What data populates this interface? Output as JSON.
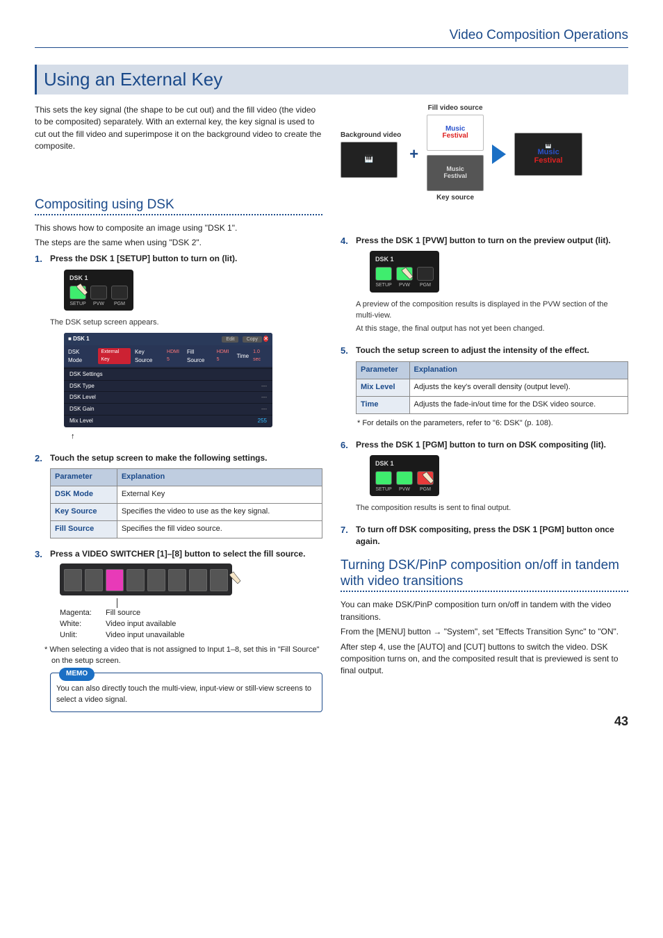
{
  "header": {
    "section_title": "Video Composition Operations"
  },
  "page_number": "43",
  "h1": "Using an External Key",
  "intro": "This sets the key signal (the shape to be cut out) and the fill video (the video to be composited) separately. With an external key, the key signal is used to cut out the fill video and superimpose it on the background video to create the composite.",
  "compdiag": {
    "bg_label": "Background video",
    "fill_label": "Fill video source",
    "key_label": "Key source",
    "mf1": "Music",
    "mf2": "Festival"
  },
  "h2a": "Compositing using DSK",
  "dsk_intro1": "This shows how to composite an image using \"DSK 1\".",
  "dsk_intro2": "The steps are the same when using \"DSK 2\".",
  "step1": {
    "num": "1.",
    "title": "Press the DSK 1 [SETUP] button to turn on (lit).",
    "after": "The DSK setup screen appears."
  },
  "panel": {
    "title": "DSK 1",
    "b1": "SETUP",
    "b2": "PVW",
    "b3": "PGM"
  },
  "screenshot": {
    "title": "DSK 1",
    "edit": "Edit",
    "copy": "Copy",
    "row2_mode": "DSK Mode",
    "row2_mode_v": "External Key",
    "row2_key": "Key Source",
    "row2_key_v": "HDMI 5",
    "row2_fill": "Fill Source",
    "row2_fill_v": "HDMI 5",
    "row2_time": "Time",
    "row2_time_v": "1.0 sec",
    "rows": [
      {
        "k": "DSK Settings",
        "v": ""
      },
      {
        "k": "DSK Type",
        "v": "---"
      },
      {
        "k": "DSK Level",
        "v": "---"
      },
      {
        "k": "DSK Gain",
        "v": "---"
      },
      {
        "k": "Mix Level",
        "v": "255"
      }
    ]
  },
  "step2": {
    "num": "2.",
    "title": "Touch the setup screen to make the following settings.",
    "table_h1": "Parameter",
    "table_h2": "Explanation",
    "rows": [
      {
        "p": "DSK Mode",
        "e": "External Key"
      },
      {
        "p": "Key Source",
        "e": "Specifies the video to use as the key signal."
      },
      {
        "p": "Fill Source",
        "e": "Specifies the fill video source."
      }
    ]
  },
  "step3": {
    "num": "3.",
    "title": "Press a VIDEO SWITCHER [1]–[8] button to select the fill source.",
    "legend": [
      {
        "l": "Magenta:",
        "v": "Fill source"
      },
      {
        "l": "White:",
        "v": "Video input available"
      },
      {
        "l": "Unlit:",
        "v": "Video input unavailable"
      }
    ],
    "note": "* When selecting a video that is not assigned to Input 1–8, set this in \"Fill Source\" on the setup screen.",
    "memo_label": "MEMO",
    "memo": "You can also directly touch the multi-view, input-view or still-view screens to select a video signal."
  },
  "step4": {
    "num": "4.",
    "title": "Press the DSK 1 [PVW] button to turn on the preview output (lit).",
    "after1": "A preview of the composition results is displayed in the PVW section of the multi-view.",
    "after2": "At this stage, the final output has not yet been changed."
  },
  "step5": {
    "num": "5.",
    "title": "Touch the setup screen to adjust the intensity of the effect.",
    "table_h1": "Parameter",
    "table_h2": "Explanation",
    "rows": [
      {
        "p": "Mix Level",
        "e": "Adjusts the key's overall density (output level)."
      },
      {
        "p": "Time",
        "e": "Adjusts the fade-in/out time for the DSK video source."
      }
    ],
    "note": "* For details on the parameters, refer to \"6: DSK\" (p. 108)."
  },
  "step6": {
    "num": "6.",
    "title": "Press the DSK 1 [PGM] button to turn on DSK compositing (lit).",
    "after": "The composition results is sent to final output."
  },
  "step7": {
    "num": "7.",
    "title": "To turn off DSK compositing, press the DSK 1 [PGM] button once again."
  },
  "h2b": "Turning DSK/PinP composition on/off in tandem with video transitions",
  "tandem1": "You can make DSK/PinP composition turn on/off in tandem with the video transitions.",
  "tandem2a": "From the [MENU] button ",
  "tandem2b": " \"System\", set \"Effects Transition Sync\" to \"ON\".",
  "tandem3": "After step 4, use the [AUTO] and [CUT] buttons to switch the video. DSK composition turns on, and the composited result that is previewed is sent to final output."
}
